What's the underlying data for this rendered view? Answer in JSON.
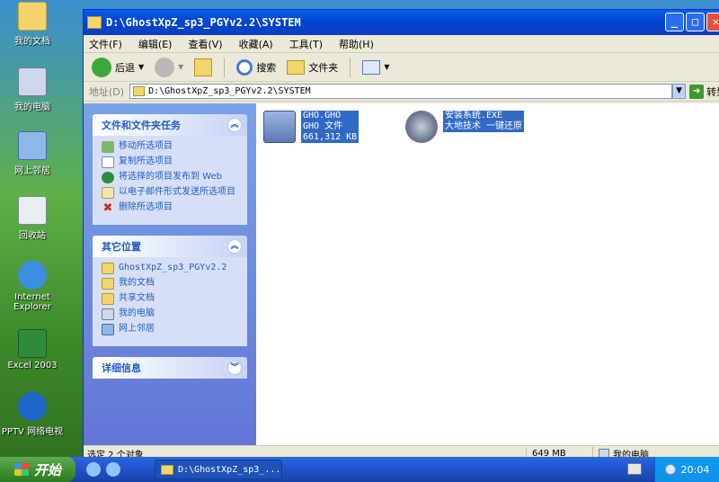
{
  "desktop": {
    "icons": [
      {
        "label": "我的文档"
      },
      {
        "label": "我的电脑"
      },
      {
        "label": "网上邻居"
      },
      {
        "label": "回收站"
      },
      {
        "label": "Internet Explorer"
      },
      {
        "label": "Excel 2003"
      },
      {
        "label": "PPTV 网络电视"
      }
    ]
  },
  "window": {
    "title": "D:\\GhostXpZ_sp3_PGYv2.2\\SYSTEM",
    "menu": [
      "文件(F)",
      "编辑(E)",
      "查看(V)",
      "收藏(A)",
      "工具(T)",
      "帮助(H)"
    ],
    "toolbar": {
      "back": "后退",
      "search": "搜索",
      "folders": "文件夹"
    },
    "address": {
      "label": "地址(D)",
      "value": "D:\\GhostXpZ_sp3_PGYv2.2\\SYSTEM",
      "go": "转到"
    }
  },
  "tasks": {
    "header": "文件和文件夹任务",
    "items": [
      "移动所选项目",
      "复制所选项目",
      "将选择的项目发布到 Web",
      "以电子邮件形式发送所选项目",
      "删除所选项目"
    ]
  },
  "other_places": {
    "header": "其它位置",
    "items": [
      "GhostXpZ_sp3_PGYv2.2",
      "我的文档",
      "共享文档",
      "我的电脑",
      "网上邻居"
    ]
  },
  "details": {
    "header": "详细信息"
  },
  "files": [
    {
      "name": "GHO.GHO",
      "type": "GHO 文件",
      "size": "661,312 KB"
    },
    {
      "name": "安装系统.EXE",
      "desc": "大地技术 一键还原"
    }
  ],
  "status": {
    "selected": "选定 2 个对象",
    "size": "649 MB",
    "location": "我的电脑"
  },
  "taskbar": {
    "start": "开始",
    "task": "D:\\GhostXpZ_sp3_...",
    "clock": "20:04"
  },
  "colors": {
    "xp_blue": "#0046d5",
    "selection": "#316ac5",
    "taskpane_link": "#215dc6"
  }
}
